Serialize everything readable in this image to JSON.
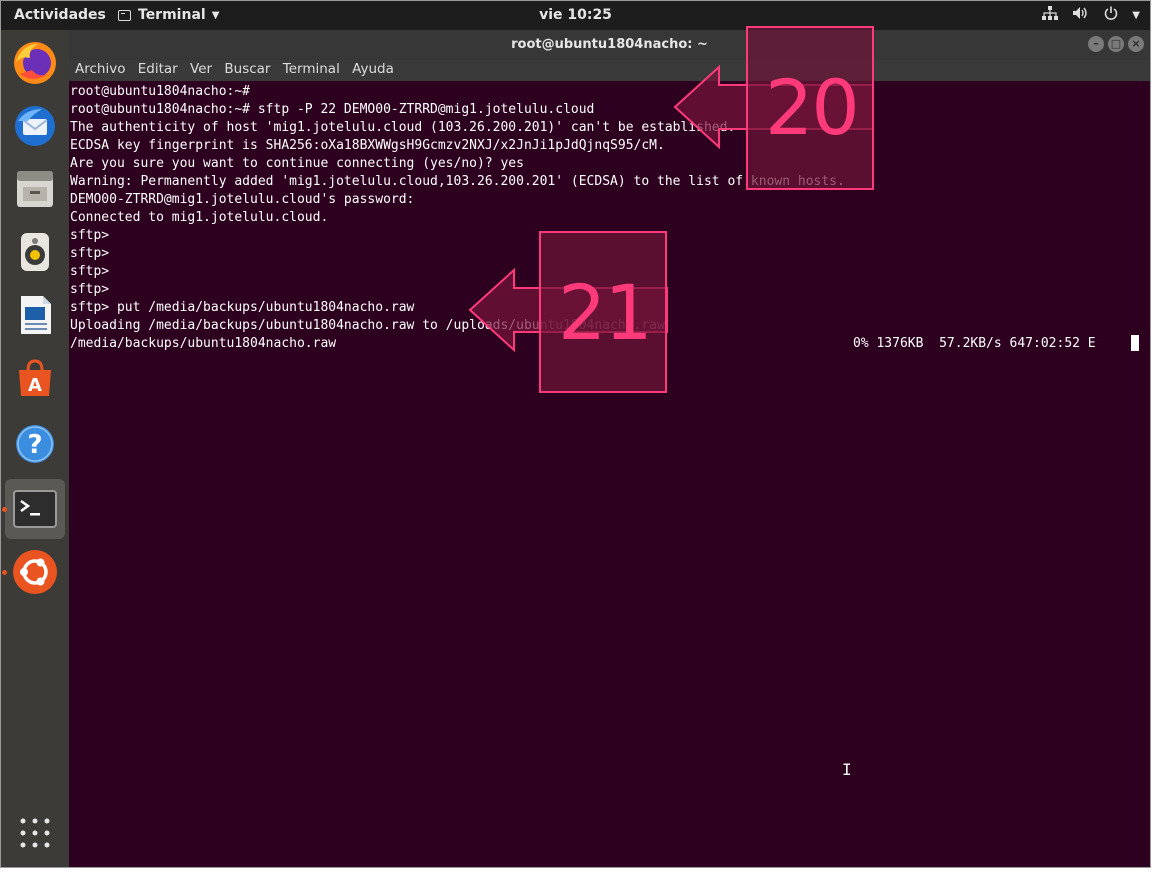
{
  "topbar": {
    "activities": "Actividades",
    "app_name": "Terminal",
    "clock": "vie 10:25"
  },
  "window": {
    "title": "root@ubuntu1804nacho: ~",
    "menu": [
      "Archivo",
      "Editar",
      "Ver",
      "Buscar",
      "Terminal",
      "Ayuda"
    ]
  },
  "terminal": {
    "lines": [
      "root@ubuntu1804nacho:~#",
      "root@ubuntu1804nacho:~# sftp -P 22 DEMO00-ZTRRD@mig1.jotelulu.cloud",
      "The authenticity of host 'mig1.jotelulu.cloud (103.26.200.201)' can't be established.",
      "ECDSA key fingerprint is SHA256:oXa18BXWWgsH9Gcmzv2NXJ/x2JnJi1pJdQjnqS95/cM.",
      "Are you sure you want to continue connecting (yes/no)? yes",
      "Warning: Permanently added 'mig1.jotelulu.cloud,103.26.200.201' (ECDSA) to the list of known hosts.",
      "DEMO00-ZTRRD@mig1.jotelulu.cloud's password:",
      "Connected to mig1.jotelulu.cloud.",
      "sftp>",
      "sftp>",
      "sftp>",
      "sftp>",
      "sftp> put /media/backups/ubuntu1804nacho.raw",
      "Uploading /media/backups/ubuntu1804nacho.raw to /uploads/ubuntu1804nacho.raw",
      "/media/backups/ubuntu1804nacho.raw"
    ],
    "progress": "0% 1376KB  57.2KB/s 647:02:52 E"
  },
  "annotations": [
    {
      "label": "20",
      "color": "#ff3a7a"
    },
    {
      "label": "21",
      "color": "#ff3a7a"
    }
  ],
  "dock": {
    "icons": [
      "firefox-icon",
      "thunderbird-icon",
      "files-icon",
      "rhythmbox-icon",
      "writer-icon",
      "software-icon",
      "help-icon",
      "terminal-icon",
      "ubuntu-icon",
      "apps-grid-icon"
    ]
  },
  "colors": {
    "terminal_bg": "#2c001e",
    "accent": "#e95420",
    "annotation": "#ff3a7a"
  }
}
